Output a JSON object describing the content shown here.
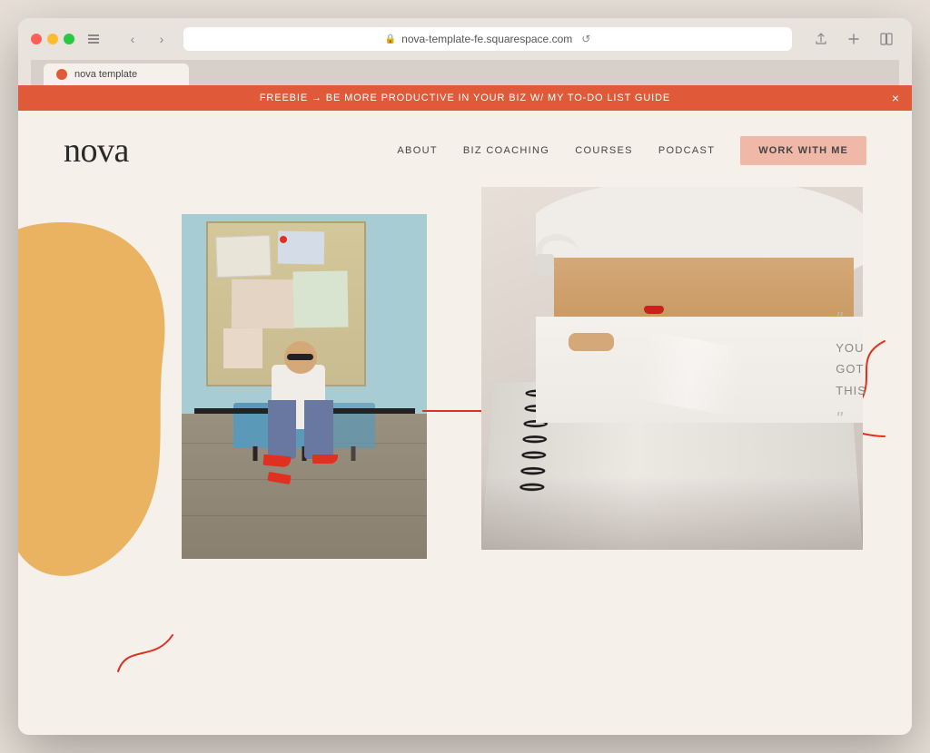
{
  "browser": {
    "url": "nova-template-fe.squarespace.com",
    "tab_label": "nova template"
  },
  "banner": {
    "text": "FREEBIE → BE MORE PRODUCTIVE IN YOUR BIZ W/ MY TO-DO LIST GUIDE",
    "close_label": "×",
    "bg_color": "#e05a3a"
  },
  "nav": {
    "logo": "nova",
    "links": [
      {
        "label": "ABOUT"
      },
      {
        "label": "BIZ COACHING"
      },
      {
        "label": "COURSES"
      },
      {
        "label": "PODCAST"
      }
    ],
    "cta": "WORK WITH ME"
  },
  "quote": {
    "open_mark": "\"",
    "line1": "YOU",
    "line2": "GOT",
    "line3": "THIS",
    "close_mark": "\""
  },
  "colors": {
    "background": "#f5f0ea",
    "banner": "#e05a3a",
    "orange_blob": "#e8a84a",
    "red_accent": "#e03020",
    "cta_button": "#f0b8a8"
  }
}
